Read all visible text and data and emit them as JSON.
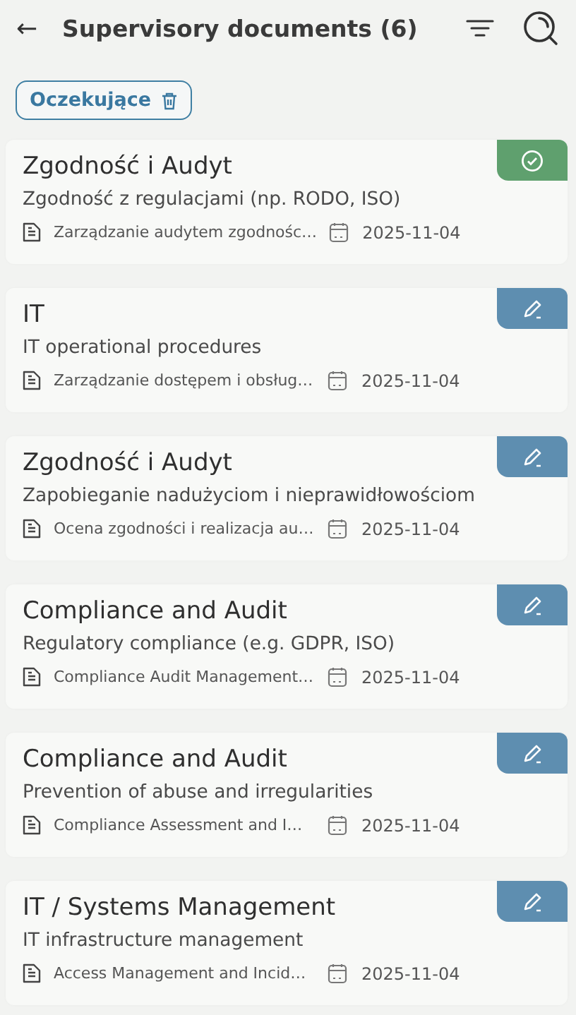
{
  "header": {
    "back": "←",
    "title": "Supervisory documents (6)"
  },
  "filter_chip": {
    "label": "Oczekujące"
  },
  "documents": [
    {
      "title": "Zgodność i Audyt",
      "subtitle": "Zgodność z regulacjami (np. RODO, ISO)",
      "procedure": "Zarządzanie audytem zgodnośc…",
      "date": "2025-11-04",
      "kind": "approved"
    },
    {
      "title": "IT",
      "subtitle": "IT operational procedures",
      "procedure": "Zarządzanie dostępem i obsług…",
      "date": "2025-11-04",
      "kind": "draft"
    },
    {
      "title": "Zgodność i Audyt",
      "subtitle": "Zapobieganie nadużyciom i nieprawidłowościom",
      "procedure": "Ocena zgodności i realizacja au…",
      "date": "2025-11-04",
      "kind": "draft"
    },
    {
      "title": "Compliance and Audit",
      "subtitle": "Regulatory compliance (e.g. GDPR, ISO)",
      "procedure": "Compliance Audit Management…",
      "date": "2025-11-04",
      "kind": "draft"
    },
    {
      "title": "Compliance and Audit",
      "subtitle": "Prevention of abuse and irregularities",
      "procedure": "Compliance Assessment and I…",
      "date": "2025-11-04",
      "kind": "draft"
    },
    {
      "title": "IT / Systems Management",
      "subtitle": "IT infrastructure management",
      "procedure": "Access Management and Incid…",
      "date": "2025-11-04",
      "kind": "draft"
    }
  ]
}
